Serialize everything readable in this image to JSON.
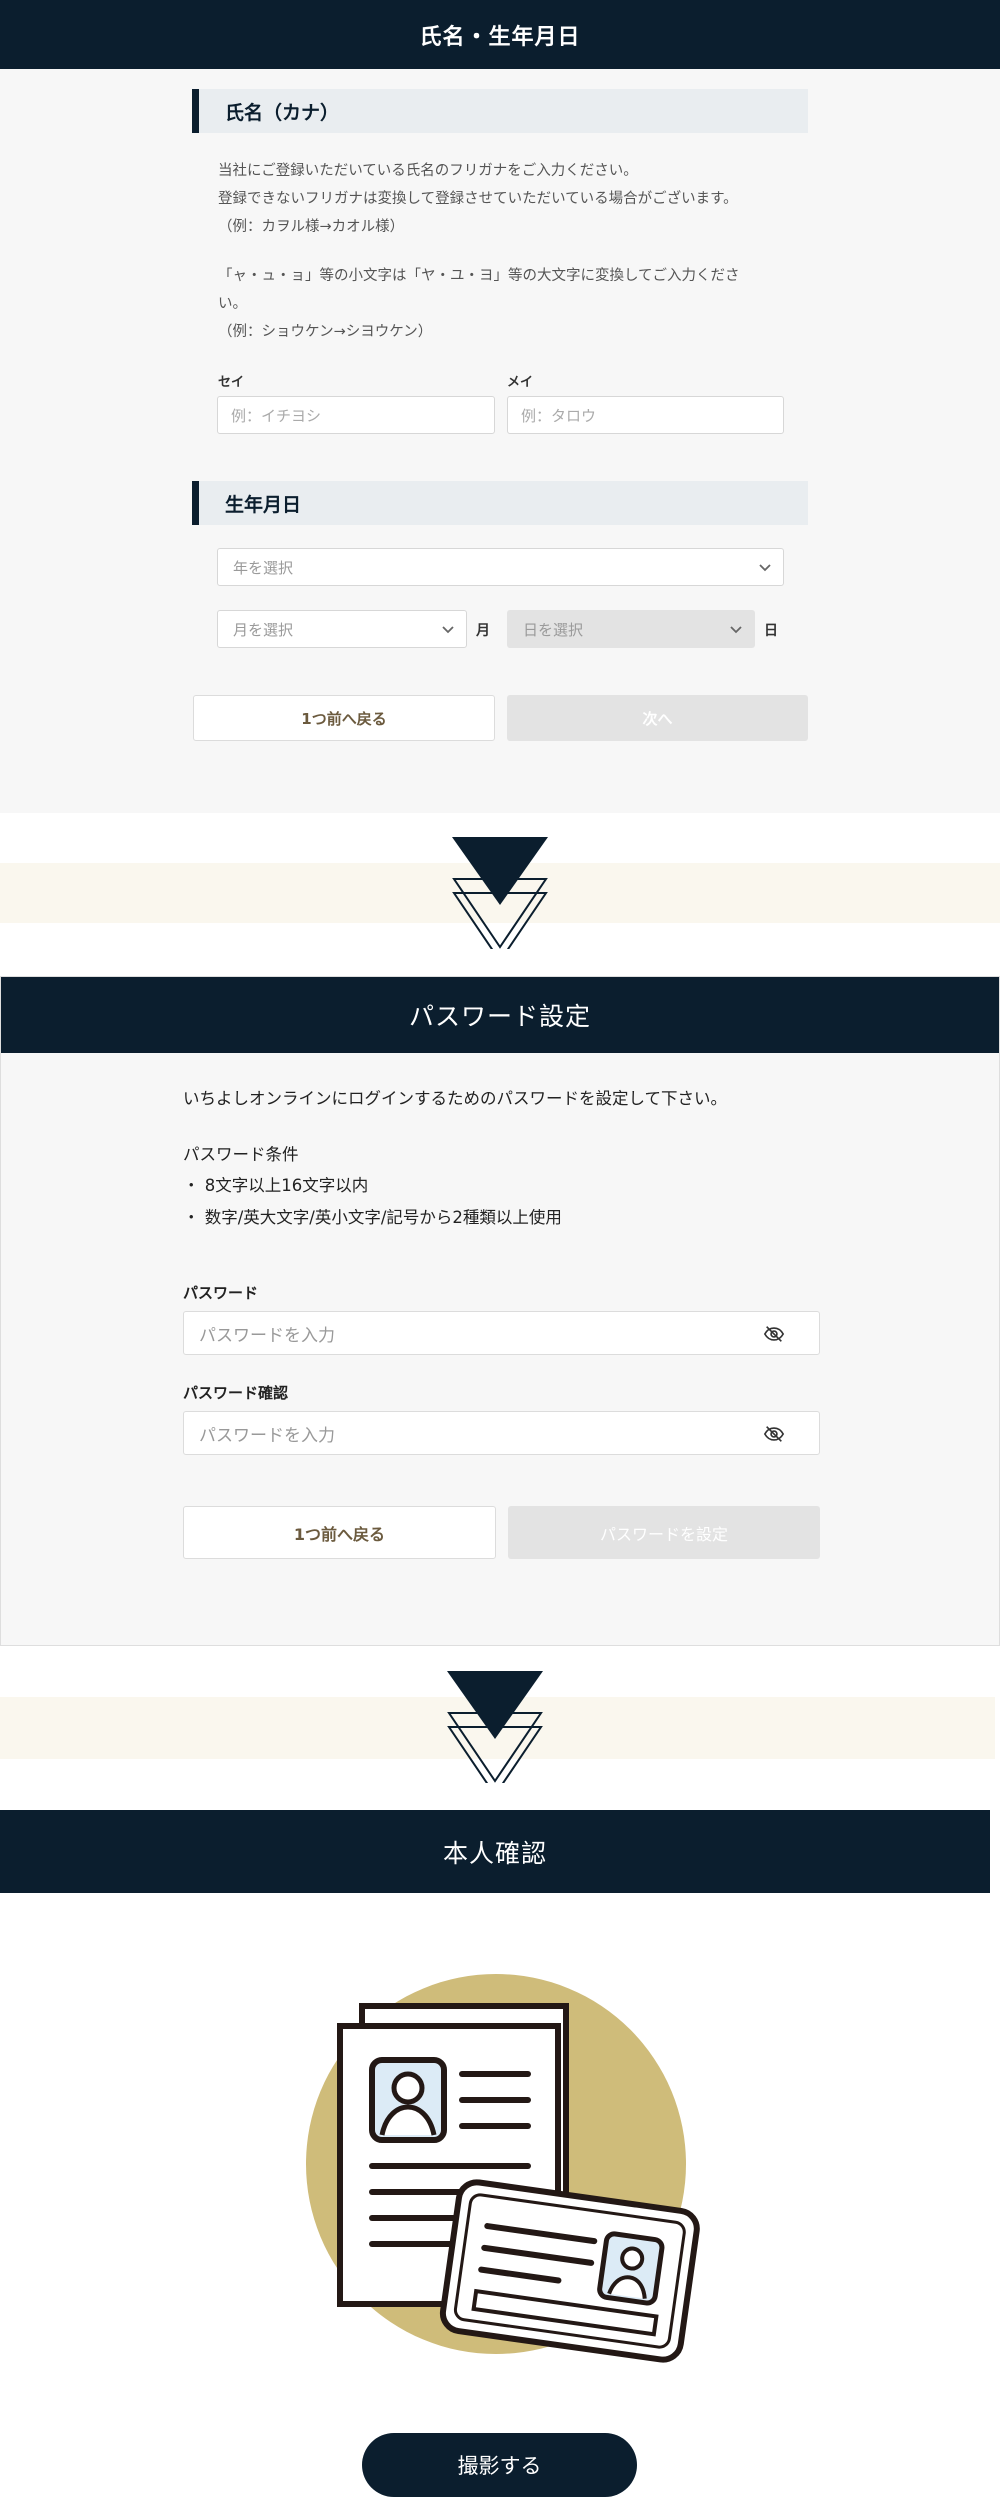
{
  "name_birth": {
    "title": "氏名・生年月日",
    "kana": {
      "heading": "氏名（カナ）",
      "notes": [
        "当社にご登録いただいている氏名のフリガナをご入力ください。",
        "登録できないフリガナは変換して登録させていただいている場合がございます。",
        "（例：カヲル様→カオル様）",
        "「ャ・ュ・ョ」等の小文字は「ヤ・ユ・ヨ」等の大文字に変換してご入力くださ",
        "い。",
        "（例：ショウケン→シヨウケン）"
      ],
      "sei_label": "セイ",
      "sei_placeholder": "例：イチヨシ",
      "mei_label": "メイ",
      "mei_placeholder": "例：タロウ"
    },
    "birth": {
      "heading": "生年月日",
      "year_placeholder": "年を選択",
      "month_placeholder": "月を選択",
      "month_unit": "月",
      "day_placeholder": "日を選択",
      "day_unit": "日"
    },
    "back_label": "1つ前へ戻る",
    "next_label": "次へ"
  },
  "password": {
    "title": "パスワード設定",
    "intro": "いちよしオンラインにログインするためのパスワードを設定して下さい。",
    "conditions_title": "パスワード条件",
    "conditions": [
      "・ 8文字以上16文字以内",
      "・ 数字/英大文字/英小文字/記号から2種類以上使用"
    ],
    "password_label": "パスワード",
    "password_placeholder": "パスワードを入力",
    "confirm_label": "パスワード確認",
    "confirm_placeholder": "パスワードを入力",
    "back_label": "1つ前へ戻る",
    "submit_label": "パスワードを設定"
  },
  "identity": {
    "title": "本人確認",
    "capture_label": "撮影する"
  },
  "colors": {
    "navy": "#0b1e2e",
    "gold": "#cfbc7a",
    "band": "#faf7ee",
    "back_text": "#6b5a3e"
  },
  "icons": [
    "chevron-down-icon",
    "eye-slash-icon",
    "id-documents-illustration",
    "down-arrow-icon"
  ]
}
